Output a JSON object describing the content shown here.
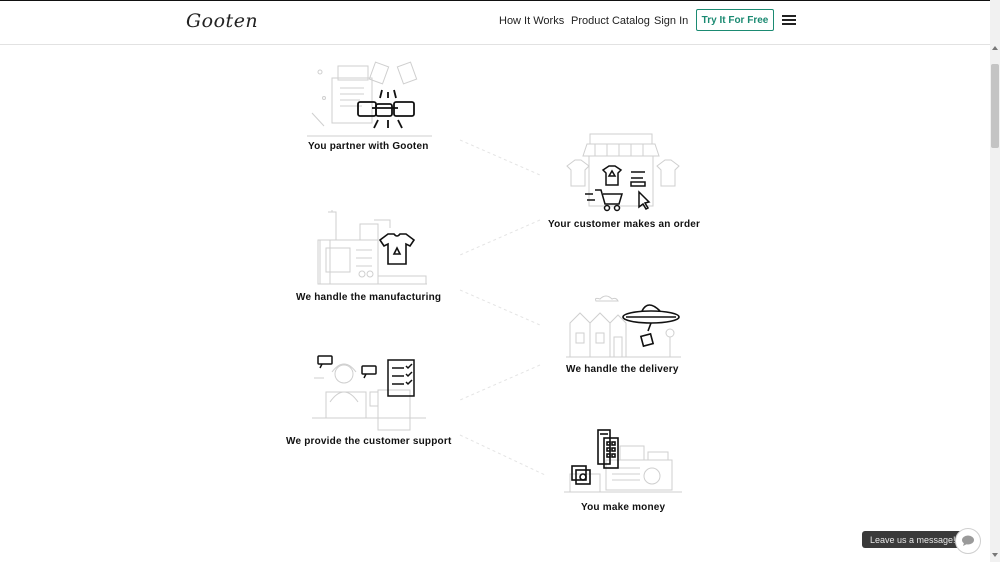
{
  "header": {
    "logo": "Gooten",
    "nav": {
      "how_it_works": "How It Works",
      "product_catalog": "Product Catalog",
      "sign_in": "Sign In"
    },
    "cta": "Try It For Free",
    "menu_icon": "hamburger-icon"
  },
  "steps": [
    {
      "label": "You partner with Gooten",
      "icon": "handshake-icon"
    },
    {
      "label": "Your customer makes an order",
      "icon": "storefront-cart-icon"
    },
    {
      "label": "We handle the manufacturing",
      "icon": "factory-tshirt-icon"
    },
    {
      "label": "We handle the delivery",
      "icon": "ufo-delivery-icon"
    },
    {
      "label": "We provide the customer support",
      "icon": "support-agent-icon"
    },
    {
      "label": "You make money",
      "icon": "cash-register-icon"
    }
  ],
  "chat": {
    "label": "Leave us a message!",
    "icon": "chat-bubble-icon"
  },
  "colors": {
    "accent": "#1b8a72",
    "line_art": "#cfcfcf",
    "ink": "#111111"
  }
}
